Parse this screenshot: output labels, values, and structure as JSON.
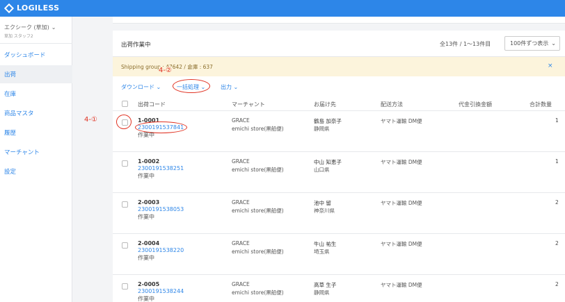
{
  "app": {
    "name": "LOGILESS"
  },
  "sidebar": {
    "account_name": "エクシーク (草加)",
    "account_sub": "草加 スタッフ2",
    "items": [
      {
        "label": "ダッシュボード"
      },
      {
        "label": "出荷",
        "active": true
      },
      {
        "label": "在庫"
      },
      {
        "label": "商品マスタ"
      },
      {
        "label": "履歴"
      },
      {
        "label": "マーチャント"
      },
      {
        "label": "設定"
      }
    ]
  },
  "annotations": {
    "step1": "4-①",
    "step2": "4-②"
  },
  "panel": {
    "title": "出荷作業中",
    "count": "全13件 / 1〜13件目",
    "per_page": "100件ずつ表示"
  },
  "banner": {
    "text": "Shipping group : 47642 / 倉庫 : 637",
    "close": "×"
  },
  "actions": {
    "download": "ダウンロード",
    "bulk": "一括処理",
    "output": "出力"
  },
  "table": {
    "headers": [
      "出荷コード",
      "マーチャント",
      "お届け先",
      "配送方法",
      "代金引換金額",
      "合計数量"
    ],
    "rows": [
      {
        "code": "1-0001",
        "tracking": "2300191537841",
        "status": "作業中",
        "merchant": "GRACE",
        "store": "emichi store(黒船便)",
        "recipient": "鶴島 加奈子",
        "prefecture": "静岡県",
        "shipping": "ヤマト運輸 DM便",
        "qty": "1"
      },
      {
        "code": "1-0002",
        "tracking": "2300191538251",
        "status": "作業中",
        "merchant": "GRACE",
        "store": "emichi store(黒船便)",
        "recipient": "中山 知恵子",
        "prefecture": "山口県",
        "shipping": "ヤマト運輸 DM便",
        "qty": "1"
      },
      {
        "code": "2-0003",
        "tracking": "2300191538053",
        "status": "作業中",
        "merchant": "GRACE",
        "store": "emichi store(黒船便)",
        "recipient": "池中 留",
        "prefecture": "神奈川県",
        "shipping": "ヤマト運輸 DM便",
        "qty": "2"
      },
      {
        "code": "2-0004",
        "tracking": "2300191538220",
        "status": "作業中",
        "merchant": "GRACE",
        "store": "emichi store(黒船便)",
        "recipient": "牛山 祐生",
        "prefecture": "埼玉県",
        "shipping": "ヤマト運輸 DM便",
        "qty": "2"
      },
      {
        "code": "2-0005",
        "tracking": "2300191538244",
        "status": "作業中",
        "merchant": "GRACE",
        "store": "emichi store(黒船便)",
        "recipient": "高草 生子",
        "prefecture": "静岡県",
        "shipping": "ヤマト運輸 DM便",
        "qty": "2"
      }
    ]
  },
  "colors": {
    "brand": "#2d86e8",
    "annotation": "#e03020",
    "banner_bg": "#fcf4dc"
  }
}
